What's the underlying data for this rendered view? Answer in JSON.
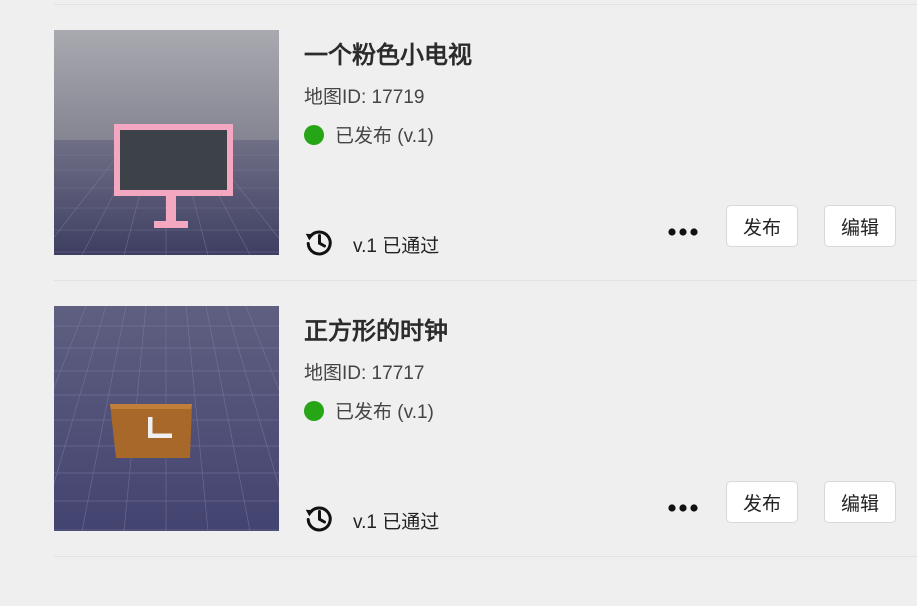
{
  "items": [
    {
      "title": "一个粉色小电视",
      "map_id_label": "地图ID: 17719",
      "status_text": "已发布 (v.1)",
      "status_color": "#26a517",
      "version_text": "v.1 已通过",
      "more_label": "•••",
      "publish_label": "发布",
      "edit_label": "编辑"
    },
    {
      "title": "正方形的时钟",
      "map_id_label": "地图ID: 17717",
      "status_text": "已发布 (v.1)",
      "status_color": "#26a517",
      "version_text": "v.1 已通过",
      "more_label": "•••",
      "publish_label": "发布",
      "edit_label": "编辑"
    }
  ]
}
